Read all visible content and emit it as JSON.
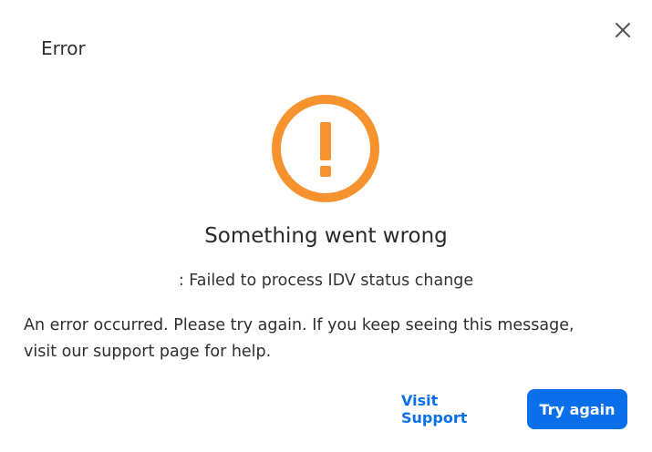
{
  "dialog": {
    "title": "Error",
    "close_icon": "close-icon",
    "alert_icon": "exclamation-circle-icon",
    "headline": "Something went wrong",
    "subline": ": Failed to process IDV status change",
    "message": "An error occurred. Please try again. If you keep seeing this message, visit our support page for help.",
    "secondary_label": "Visit Support",
    "primary_label": "Try again"
  },
  "colors": {
    "alert_orange": "#f7932f",
    "primary_blue": "#0a6fe8"
  }
}
